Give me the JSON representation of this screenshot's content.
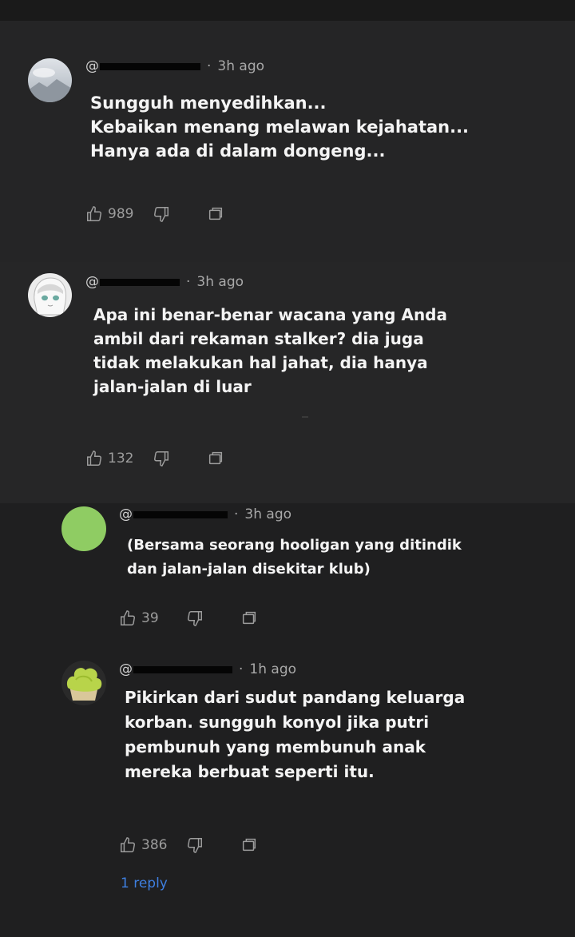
{
  "comments": [
    {
      "handle": "@",
      "time": "3h ago",
      "lines": [
        "Sungguh menyedihkan...",
        "Kebaikan menang melawan kejahatan...",
        "Hanya ada di dalam dongeng..."
      ],
      "likes": "989"
    },
    {
      "handle": "@",
      "time": "3h ago",
      "lines": [
        "Apa ini benar-benar wacana yang Anda",
        "ambil dari rekaman stalker? dia juga",
        "tidak melakukan hal jahat, dia hanya",
        "jalan-jalan di luar"
      ],
      "likes": "132"
    },
    {
      "handle": "@",
      "time": "3h ago",
      "lines": [
        "(Bersama seorang hooligan yang ditindik",
        "dan jalan-jalan disekitar klub)"
      ],
      "likes": "39"
    },
    {
      "handle": "@",
      "time": "1h ago",
      "lines": [
        "Pikirkan dari sudut pandang keluarga",
        "korban. sungguh konyol jika putri",
        "pembunuh yang membunuh anak",
        "mereka berbuat seperti itu."
      ],
      "likes": "386",
      "replies": "1 reply"
    }
  ],
  "separator": "·",
  "icons": [
    "like-icon",
    "dislike-icon",
    "reply-icon"
  ],
  "colors": {
    "reply_link": "#3e7fe0",
    "avatar_green": "#8fcc63"
  }
}
